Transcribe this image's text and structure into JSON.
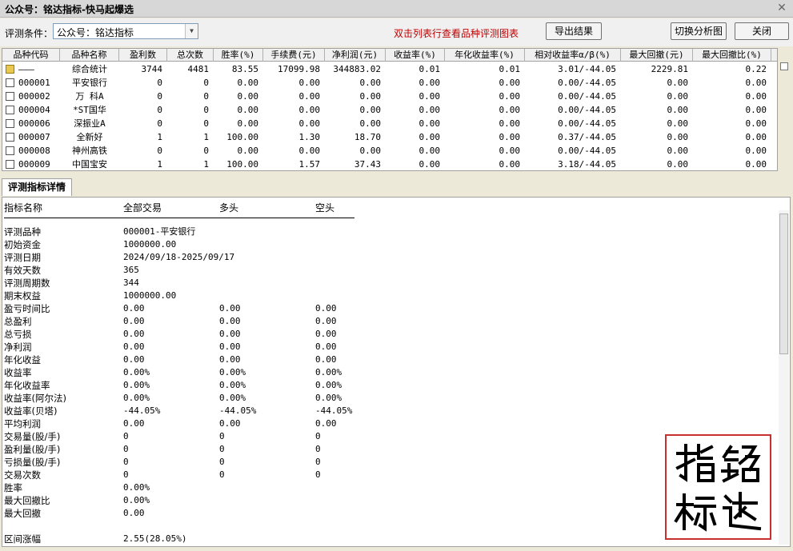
{
  "window": {
    "title": "公众号：铭达指标-快马起爆选",
    "close_glyph": "✕"
  },
  "toolbar": {
    "condition_label": "评测条件：",
    "condition_value": "公众号：铭达指标",
    "hint": "双击列表行查看品种评测图表",
    "export_label": "导出结果",
    "switch_label": "切换分析图",
    "close_label": "关闭"
  },
  "grid": {
    "columns": [
      "品种代码",
      "品种名称",
      "盈利数",
      "总次数",
      "胜率(%)",
      "手续费(元)",
      "净利润(元)",
      "收益率(%)",
      "年化收益率(%)",
      "相对收益率α/β(%)",
      "最大回撤(元)",
      "最大回撤比(%)"
    ],
    "rows": [
      [
        "———",
        "综合统计",
        "3744",
        "4481",
        "83.55",
        "17099.98",
        "344883.02",
        "0.01",
        "0.01",
        "3.01/-44.05",
        "2229.81",
        "0.22"
      ],
      [
        "000001",
        "平安银行",
        "0",
        "0",
        "0.00",
        "0.00",
        "0.00",
        "0.00",
        "0.00",
        "0.00/-44.05",
        "0.00",
        "0.00"
      ],
      [
        "000002",
        "万 科A",
        "0",
        "0",
        "0.00",
        "0.00",
        "0.00",
        "0.00",
        "0.00",
        "0.00/-44.05",
        "0.00",
        "0.00"
      ],
      [
        "000004",
        "*ST国华",
        "0",
        "0",
        "0.00",
        "0.00",
        "0.00",
        "0.00",
        "0.00",
        "0.00/-44.05",
        "0.00",
        "0.00"
      ],
      [
        "000006",
        "深振业A",
        "0",
        "0",
        "0.00",
        "0.00",
        "0.00",
        "0.00",
        "0.00",
        "0.00/-44.05",
        "0.00",
        "0.00"
      ],
      [
        "000007",
        "全新好",
        "1",
        "1",
        "100.00",
        "1.30",
        "18.70",
        "0.00",
        "0.00",
        "0.37/-44.05",
        "0.00",
        "0.00"
      ],
      [
        "000008",
        "神州高铁",
        "0",
        "0",
        "0.00",
        "0.00",
        "0.00",
        "0.00",
        "0.00",
        "0.00/-44.05",
        "0.00",
        "0.00"
      ],
      [
        "000009",
        "中国宝安",
        "1",
        "1",
        "100.00",
        "1.57",
        "37.43",
        "0.00",
        "0.00",
        "3.18/-44.05",
        "0.00",
        "0.00"
      ]
    ]
  },
  "detail": {
    "tab_label": "评测指标详情",
    "headers": [
      "指标名称",
      "全部交易",
      "多头",
      "空头"
    ],
    "rows": [
      [
        "评测品种",
        "000001-平安银行",
        "",
        ""
      ],
      [
        "初始资金",
        "1000000.00",
        "",
        ""
      ],
      [
        "评测日期",
        "2024/09/18-2025/09/17",
        "",
        ""
      ],
      [
        "有效天数",
        "365",
        "",
        ""
      ],
      [
        "评测周期数",
        "344",
        "",
        ""
      ],
      [
        "期末权益",
        "1000000.00",
        "",
        ""
      ],
      [
        "盈亏时间比",
        "0.00",
        "0.00",
        "0.00"
      ],
      [
        "总盈利",
        "0.00",
        "0.00",
        "0.00"
      ],
      [
        "总亏损",
        "0.00",
        "0.00",
        "0.00"
      ],
      [
        "净利润",
        "0.00",
        "0.00",
        "0.00"
      ],
      [
        "年化收益",
        "0.00",
        "0.00",
        "0.00"
      ],
      [
        "收益率",
        "0.00%",
        "0.00%",
        "0.00%"
      ],
      [
        "年化收益率",
        "0.00%",
        "0.00%",
        "0.00%"
      ],
      [
        "收益率(阿尔法)",
        "0.00%",
        "0.00%",
        "0.00%"
      ],
      [
        "收益率(贝塔)",
        "-44.05%",
        "-44.05%",
        "-44.05%"
      ],
      [
        "平均利润",
        "0.00",
        "0.00",
        "0.00"
      ],
      [
        "交易量(股/手)",
        "0",
        "0",
        "0"
      ],
      [
        "盈利量(股/手)",
        "0",
        "0",
        "0"
      ],
      [
        "亏损量(股/手)",
        "0",
        "0",
        "0"
      ],
      [
        "交易次数",
        "0",
        "0",
        "0"
      ],
      [
        "胜率",
        "0.00%",
        "",
        ""
      ],
      [
        "最大回撤比",
        "0.00%",
        "",
        ""
      ],
      [
        "最大回撤",
        "0.00",
        "",
        ""
      ],
      [
        "",
        "",
        "",
        ""
      ],
      [
        "区间涨幅",
        "2.55(28.05%)",
        "",
        ""
      ]
    ]
  },
  "seal": {
    "chars": [
      "铭",
      "达",
      "指",
      "标"
    ],
    "color": "#c83030"
  }
}
